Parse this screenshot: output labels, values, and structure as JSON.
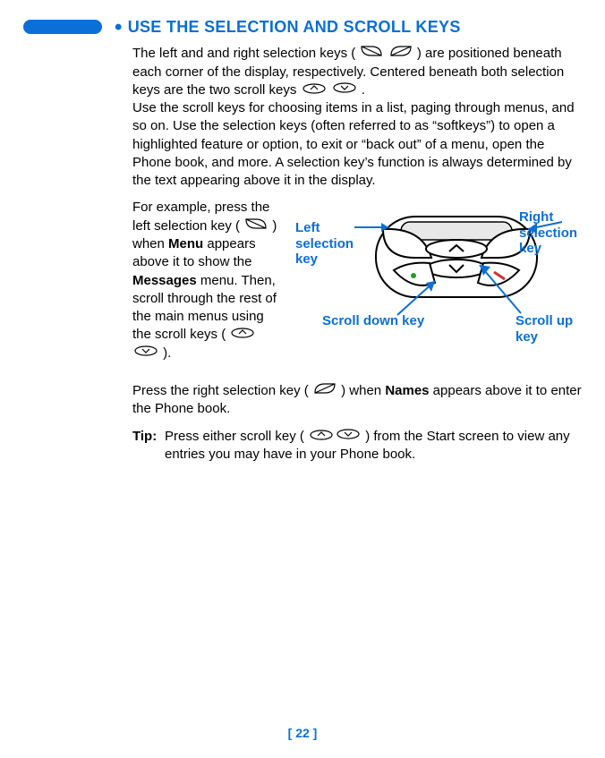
{
  "section": {
    "title": "USE THE SELECTION AND SCROLL KEYS"
  },
  "intro": {
    "part1": "The left and and right selection keys (",
    "part2": ") are positioned beneath each corner of the display, respectively. Centered beneath both selection keys are the two scroll keys ",
    "part3": ".",
    "part4": "Use the scroll keys for choosing items in a list, paging through menus, and so on. Use the selection keys (often referred to as “softkeys”) to open a highlighted feature or option, to exit or “back out” of a menu, open the Phone book, and more. A selection key’s function is always determined by the text appearing above it in the display."
  },
  "example": {
    "p1a": "For example, press the left selection key (",
    "p1b": ") when ",
    "menu_bold": "Menu",
    "p1c": " appears above it to show the ",
    "messages_bold": "Messages",
    "p1d": " menu. Then, scroll through the rest of the main menus using the scroll keys (",
    "p1e": ")."
  },
  "callouts": {
    "left": "Left selection key",
    "right": "Right selection key",
    "scroll_down": "Scroll down key",
    "scroll_up": "Scroll up key"
  },
  "press_right": {
    "a": "Press the right selection key (",
    "b": " ) when ",
    "names_bold": "Names",
    "c": " appears above it to enter the Phone book."
  },
  "tip": {
    "label": "Tip:",
    "a": "Press either scroll key (",
    "b": ") from the Start screen to view any entries you may have in your Phone book."
  },
  "footer": {
    "page": "[ 22 ]"
  }
}
